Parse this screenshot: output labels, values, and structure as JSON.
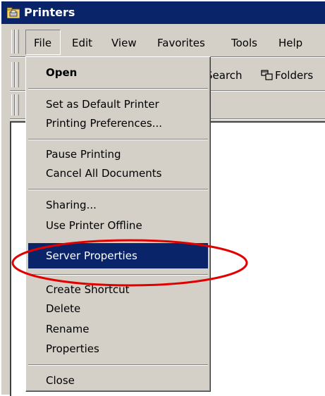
{
  "window": {
    "title": "Printers"
  },
  "menubar": {
    "items": [
      "File",
      "Edit",
      "View",
      "Favorites",
      "Tools",
      "Help"
    ]
  },
  "toolbar": {
    "search_label": "Search",
    "folders_label": "Folders"
  },
  "file_menu": {
    "items": [
      "Open",
      "Set as Default Printer",
      "Printing Preferences...",
      "Pause Printing",
      "Cancel All Documents",
      "Sharing...",
      "Use Printer Offline",
      "Server Properties",
      "Create Shortcut",
      "Delete",
      "Rename",
      "Properties",
      "Close"
    ],
    "selected_index": 7
  },
  "annotation": {
    "circle_color": "#e00000"
  }
}
